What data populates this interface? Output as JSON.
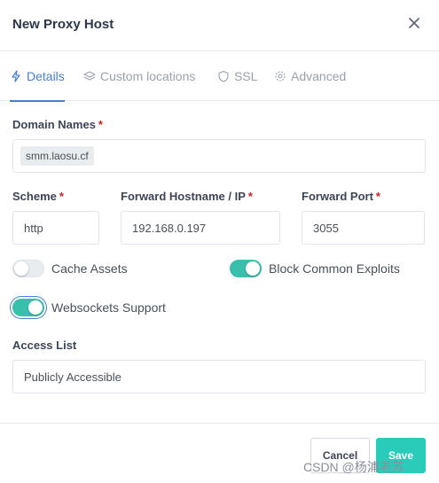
{
  "modal": {
    "title": "New Proxy Host"
  },
  "tabs": [
    {
      "label": "Details",
      "icon": "bolt-icon",
      "active": true
    },
    {
      "label": "Custom locations",
      "icon": "layers-icon",
      "active": false
    },
    {
      "label": "SSL",
      "icon": "shield-icon",
      "active": false
    },
    {
      "label": "Advanced",
      "icon": "gear-icon",
      "active": false
    }
  ],
  "domain_names": {
    "label": "Domain Names",
    "required": "*",
    "values": [
      "smm.laosu.cf"
    ]
  },
  "scheme": {
    "label": "Scheme",
    "required": "*",
    "value": "http"
  },
  "forward_host": {
    "label": "Forward Hostname / IP",
    "required": "*",
    "value": "192.168.0.197"
  },
  "forward_port": {
    "label": "Forward Port",
    "required": "*",
    "value": "3055"
  },
  "toggles": {
    "cache_assets": {
      "label": "Cache Assets",
      "on": false
    },
    "block_exploits": {
      "label": "Block Common Exploits",
      "on": true
    },
    "websockets": {
      "label": "Websockets Support",
      "on": true
    }
  },
  "access_list": {
    "label": "Access List",
    "value": "Publicly Accessible"
  },
  "footer": {
    "cancel_label": "Cancel",
    "save_label": "Save"
  },
  "watermark": "CSDN @杨浦老苏",
  "colors": {
    "accent": "#467fcf",
    "toggle_on": "#3bbfad",
    "save": "#2bcbba",
    "required": "#cd201f"
  }
}
